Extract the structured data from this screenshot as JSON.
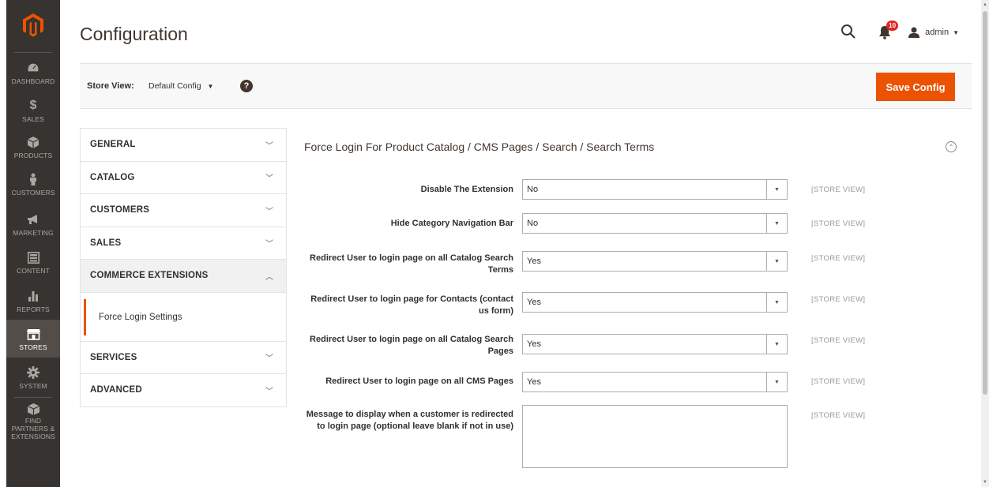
{
  "sidebar": {
    "items": [
      {
        "label": "DASHBOARD",
        "icon": "dashboard-icon"
      },
      {
        "label": "SALES",
        "icon": "dollar-icon"
      },
      {
        "label": "PRODUCTS",
        "icon": "cube-icon"
      },
      {
        "label": "CUSTOMERS",
        "icon": "person-icon"
      },
      {
        "label": "MARKETING",
        "icon": "megaphone-icon"
      },
      {
        "label": "CONTENT",
        "icon": "layout-icon"
      },
      {
        "label": "REPORTS",
        "icon": "bar-chart-icon"
      },
      {
        "label": "STORES",
        "icon": "store-icon"
      },
      {
        "label": "SYSTEM",
        "icon": "gear-icon"
      },
      {
        "label": "FIND PARTNERS & EXTENSIONS",
        "icon": "box-icon"
      }
    ],
    "active": "STORES"
  },
  "header": {
    "title": "Configuration",
    "notifications_count": "10",
    "user": "admin"
  },
  "store_bar": {
    "label": "Store View:",
    "value": "Default Config",
    "save_label": "Save Config"
  },
  "tabs": {
    "general": "GENERAL",
    "catalog": "CATALOG",
    "customers": "CUSTOMERS",
    "sales": "SALES",
    "commerce_extensions": "COMMERCE EXTENSIONS",
    "force_login": "Force Login Settings",
    "services": "SERVICES",
    "advanced": "ADVANCED"
  },
  "section": {
    "title": "Force Login For Product Catalog / CMS Pages / Search / Search Terms",
    "fields": [
      {
        "label": "Disable The Extension",
        "value": "No",
        "scope": "[STORE VIEW]"
      },
      {
        "label": "Hide Category Navigation Bar",
        "value": "No",
        "scope": "[STORE VIEW]"
      },
      {
        "label": "Redirect User to login page on all Catalog Search Terms",
        "value": "Yes",
        "scope": "[STORE VIEW]"
      },
      {
        "label": "Redirect User to login page for Contacts (contact us form)",
        "value": "Yes",
        "scope": "[STORE VIEW]"
      },
      {
        "label": "Redirect User to login page on all Catalog Search Pages",
        "value": "Yes",
        "scope": "[STORE VIEW]"
      },
      {
        "label": "Redirect User to login page on all CMS Pages",
        "value": "Yes",
        "scope": "[STORE VIEW]"
      },
      {
        "label": "Message to display when a customer is redirected to login page (optional leave blank if not in use)",
        "value": "",
        "scope": "[STORE VIEW]"
      }
    ]
  },
  "colors": {
    "sidebar_bg": "#373330",
    "accent": "#eb5202",
    "badge": "#e22626"
  }
}
